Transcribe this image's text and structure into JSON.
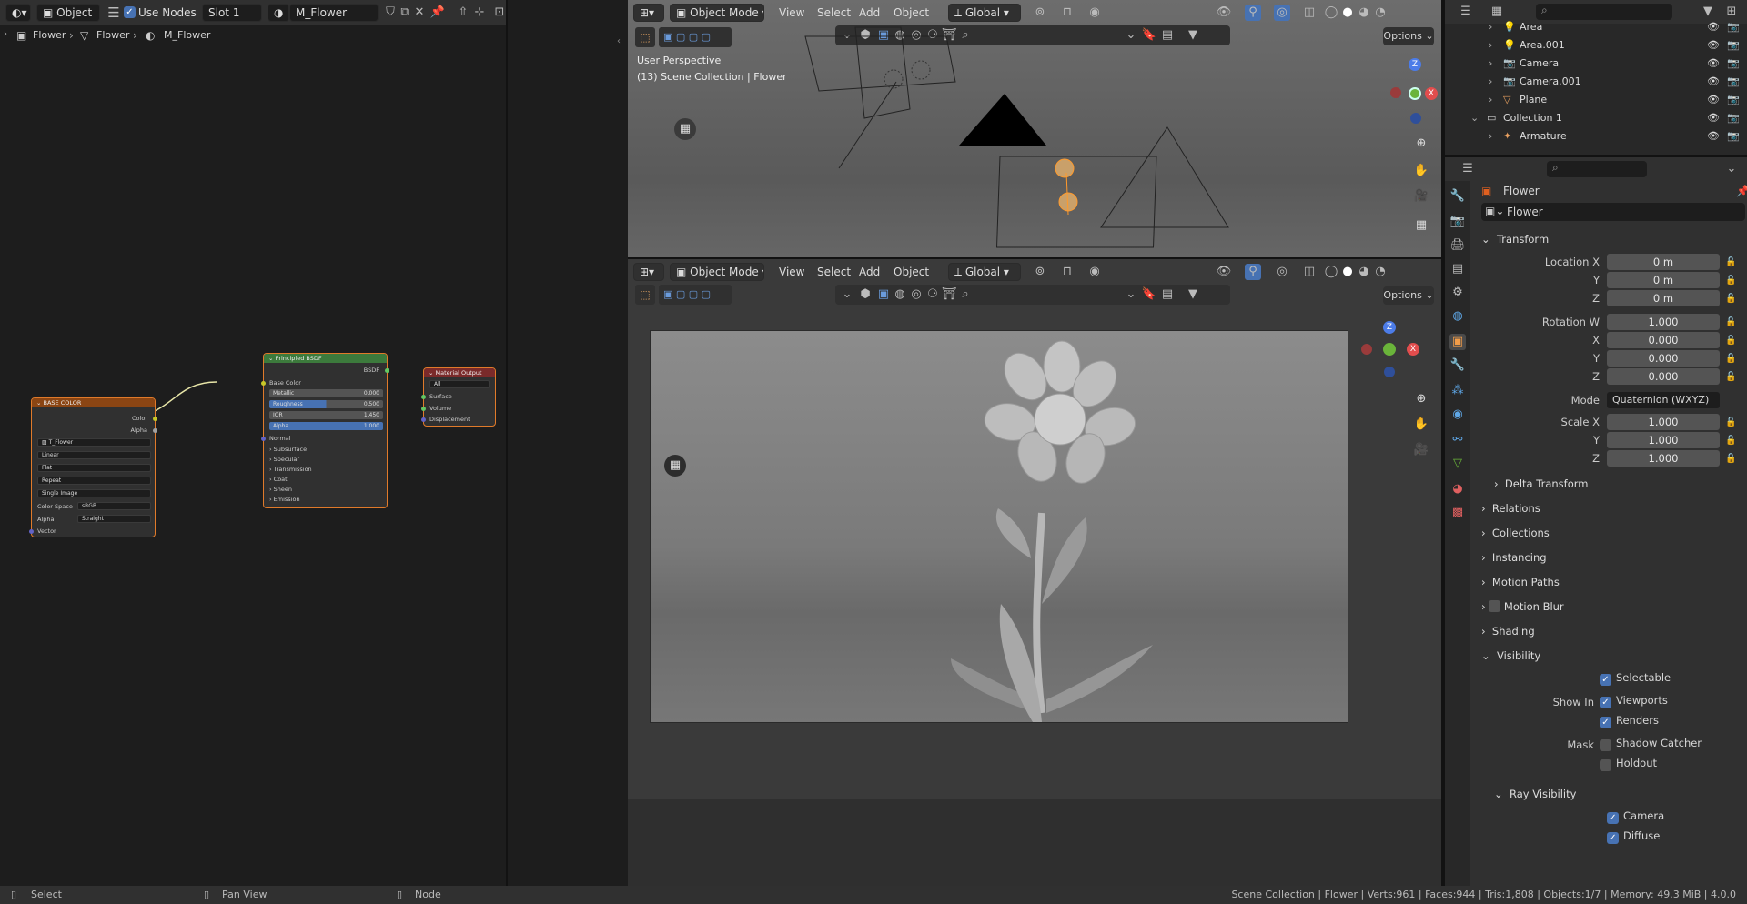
{
  "node_editor": {
    "header": {
      "editor_type": "Object",
      "use_nodes": "Use Nodes",
      "slot": "Slot 1",
      "material": "M_Flower"
    },
    "breadcrumb": [
      "Flower",
      "Flower",
      "M_Flower"
    ],
    "base_color_node": {
      "title": "BASE COLOR",
      "out_color": "Color",
      "out_alpha": "Alpha",
      "image": "T_Flower",
      "interp": "Linear",
      "projection": "Flat",
      "extension": "Repeat",
      "source": "Single Image",
      "cs_label": "Color Space",
      "cs_value": "sRGB",
      "alpha_label": "Alpha",
      "alpha_value": "Straight",
      "vector": "Vector"
    },
    "bsdf_node": {
      "title": "Principled BSDF",
      "out": "BSDF",
      "base_color": "Base Color",
      "metallic": "Metallic",
      "metallic_v": "0.000",
      "roughness": "Roughness",
      "roughness_v": "0.500",
      "ior": "IOR",
      "ior_v": "1.450",
      "alpha": "Alpha",
      "alpha_v": "1.000",
      "normal": "Normal",
      "subsurface": "Subsurface",
      "specular": "Specular",
      "transmission": "Transmission",
      "coat": "Coat",
      "sheen": "Sheen",
      "emission": "Emission"
    },
    "output_node": {
      "title": "Material Output",
      "target": "All",
      "surface": "Surface",
      "volume": "Volume",
      "displacement": "Displacement"
    }
  },
  "viewport_top": {
    "mode": "Object Mode",
    "menus": [
      "View",
      "Select",
      "Add",
      "Object"
    ],
    "orientation": "Global",
    "options": "Options",
    "perspective": "User Perspective",
    "collection_path": "(13) Scene Collection | Flower"
  },
  "viewport_bottom": {
    "mode": "Object Mode",
    "menus": [
      "View",
      "Select",
      "Add",
      "Object"
    ],
    "orientation": "Global",
    "options": "Options"
  },
  "outliner": {
    "rows": [
      {
        "name": "Area",
        "indent": 1
      },
      {
        "name": "Area.001",
        "indent": 1
      },
      {
        "name": "Camera",
        "indent": 1
      },
      {
        "name": "Camera.001",
        "indent": 1
      },
      {
        "name": "Plane",
        "indent": 1
      },
      {
        "name": "Collection 1",
        "indent": 0
      },
      {
        "name": "Armature",
        "indent": 1
      }
    ]
  },
  "properties": {
    "object_name": "Flower",
    "object_field": "Flower",
    "transform": "Transform",
    "location_label": "Location X",
    "loc": [
      "0 m",
      "0 m",
      "0 m"
    ],
    "rotation_label": "Rotation W",
    "rot": [
      "1.000",
      "0.000",
      "0.000",
      "0.000"
    ],
    "mode_label": "Mode",
    "mode_value": "Quaternion (WXYZ)",
    "scale_label": "Scale X",
    "scale": [
      "1.000",
      "1.000",
      "1.000"
    ],
    "y": "Y",
    "z": "Z",
    "x": "X",
    "delta": "Delta Transform",
    "sections": [
      "Relations",
      "Collections",
      "Instancing",
      "Motion Paths",
      "Motion Blur",
      "Shading"
    ],
    "visibility": "Visibility",
    "selectable": "Selectable",
    "show_in": "Show In",
    "viewports": "Viewports",
    "renders": "Renders",
    "mask": "Mask",
    "shadow_catcher": "Shadow Catcher",
    "holdout": "Holdout",
    "ray_visibility": "Ray Visibility",
    "camera": "Camera",
    "diffuse": "Diffuse"
  },
  "status": {
    "select": "Select",
    "pan": "Pan View",
    "node": "Node",
    "stats": "Scene Collection | Flower | Verts:961 | Faces:944 | Tris:1,808 | Objects:1/7 | Memory: 49.3 MiB | 4.0.0"
  }
}
